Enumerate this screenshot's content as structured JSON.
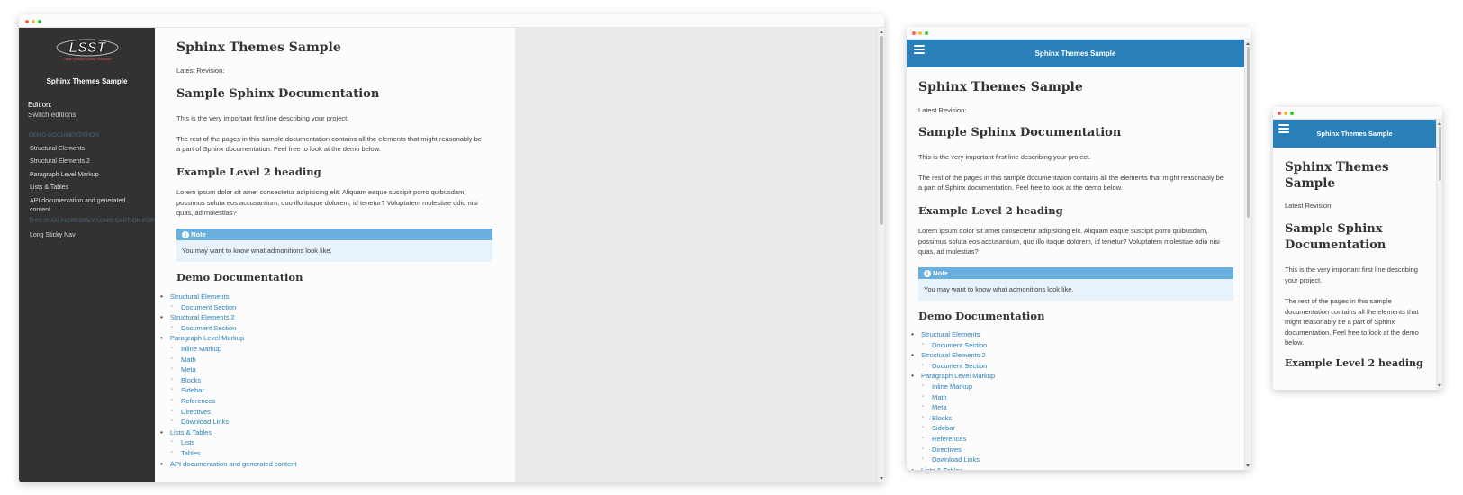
{
  "sidebar": {
    "title": "Sphinx Themes Sample",
    "edition_label": "Edition:",
    "switch_label": "Switch editions",
    "caption1": "Demo Documentation",
    "items": [
      "Structural Elements",
      "Structural Elements 2",
      "Paragraph Level Markup",
      "Lists & Tables",
      "API documentation and generated content"
    ],
    "caption2": "This is an incredibly long caption for",
    "items2": [
      "Long Sticky Nav"
    ]
  },
  "logo": {
    "text": "LSST",
    "subtitle": "Large Synoptic Survey Telescope"
  },
  "page": {
    "title": "Sphinx Themes Sample",
    "revision": "Latest Revision:",
    "h_sample": "Sample Sphinx Documentation",
    "p1": "This is the very important first line describing your project.",
    "p2": "The rest of the pages in this sample documentation contains all the elements that might reasonably be a part of Sphinx documentation. Feel free to look at the demo below.",
    "h_level2": "Example Level 2 heading",
    "p3": "Lorem ipsum dolor sit amet consectetur adipisicing elit. Aliquam eaque suscipit porro quibusdam, possimus soluta eos accusantium, quo illo itaque dolorem, id tenetur? Voluptatem molestiae odio nisi quas, ad molestias?",
    "note_title": "Note",
    "note_body": "You may want to know what admonitions look like.",
    "h_demo": "Demo Documentation",
    "toc": [
      {
        "label": "Structural Elements",
        "children": [
          "Document Section"
        ]
      },
      {
        "label": "Structural Elements 2",
        "children": [
          "Document Section"
        ]
      },
      {
        "label": "Paragraph Level Markup",
        "children": [
          "Inline Markup",
          "Math",
          "Meta",
          "Blocks",
          "Sidebar",
          "References",
          "Directives",
          "Download Links"
        ]
      },
      {
        "label": "Lists & Tables",
        "children": [
          "Lists",
          "Tables"
        ]
      },
      {
        "label": "API documentation and generated content",
        "children": []
      }
    ]
  },
  "topnav": {
    "title": "Sphinx Themes Sample"
  },
  "colors": {
    "sidebar": "#343131",
    "link": "#2980b9",
    "note_title": "#6ab0de",
    "note_body": "#e7f2fa",
    "topnav": "#2980b9"
  },
  "icons": {
    "menu": "hamburger-icon",
    "note": "info-circle-icon"
  }
}
